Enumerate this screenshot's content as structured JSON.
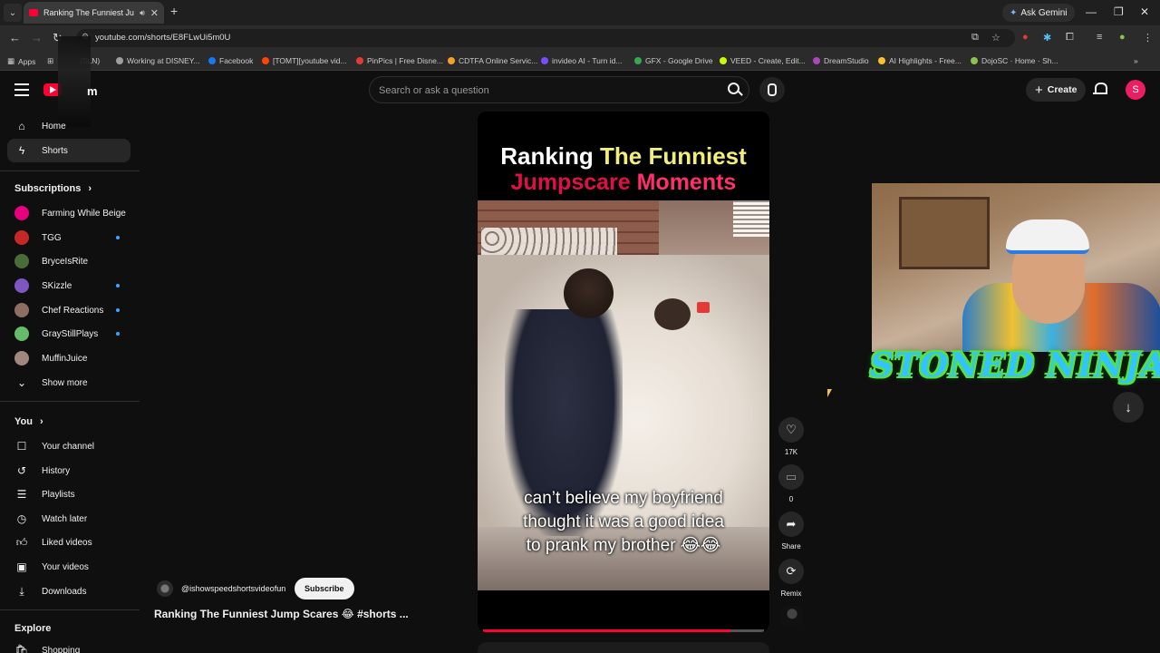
{
  "browser": {
    "tab_title": "Ranking The Funniest Jump",
    "url": "youtube.com/shorts/E8FLwUi5m0U",
    "ask_gemini": "Ask Gemini",
    "bookmarks": [
      {
        "label": "Apps",
        "color": "#8ab4f8"
      },
      {
        "label": "(SLN)",
        "color": "#cccccc"
      },
      {
        "label": "Working at DISNEY...",
        "color": "#9e9e9e"
      },
      {
        "label": "Facebook",
        "color": "#1877f2"
      },
      {
        "label": "[TOMT][youtube vid...",
        "color": "#ff4500"
      },
      {
        "label": "PinPics | Free Disne...",
        "color": "#e53935"
      },
      {
        "label": "CDTFA Online Servic...",
        "color": "#f4a02a"
      },
      {
        "label": "invideo AI - Turn id...",
        "color": "#7c4dff"
      },
      {
        "label": "GFX - Google Drive",
        "color": "#34a853"
      },
      {
        "label": "VEED - Create, Edit...",
        "color": "#c6ff00"
      },
      {
        "label": "DreamStudio",
        "color": "#ab47bc"
      },
      {
        "label": "AI Highlights - Free...",
        "color": "#fbc02d"
      },
      {
        "label": "DojoSC · Home · Sh...",
        "color": "#8bc34a"
      }
    ]
  },
  "header": {
    "logo_text": "m",
    "search_placeholder": "Search or ask a question",
    "create_label": "Create",
    "avatar_letter": "S"
  },
  "sidebar": {
    "main": [
      {
        "label": "Home",
        "icon": "home-icon"
      },
      {
        "label": "Shorts",
        "icon": "shorts-icon"
      }
    ],
    "subscriptions_heading": "Subscriptions",
    "subscriptions": [
      {
        "label": "Farming While Beige",
        "color": "#e6007e",
        "live": false
      },
      {
        "label": "TGG",
        "color": "#c62828",
        "live": true
      },
      {
        "label": "BryceIsRite",
        "color": "#4a6b3a",
        "live": false
      },
      {
        "label": "SKizzle",
        "color": "#7e57c2",
        "live": true
      },
      {
        "label": "Chef Reactions",
        "color": "#8d6e63",
        "live": true
      },
      {
        "label": "GrayStillPlays",
        "color": "#66bb6a",
        "live": true
      },
      {
        "label": "MuffinJuice",
        "color": "#a1887f",
        "live": false
      }
    ],
    "show_more": "Show more",
    "you_heading": "You",
    "you_items": [
      {
        "label": "Your channel",
        "icon": "channel-icon"
      },
      {
        "label": "History",
        "icon": "history-icon"
      },
      {
        "label": "Playlists",
        "icon": "playlists-icon"
      },
      {
        "label": "Watch later",
        "icon": "watch-later-icon"
      },
      {
        "label": "Liked videos",
        "icon": "thumbs-up-icon"
      },
      {
        "label": "Your videos",
        "icon": "your-videos-icon"
      },
      {
        "label": "Downloads",
        "icon": "download-icon"
      }
    ],
    "explore_heading": "Explore",
    "explore_items": [
      {
        "label": "Shopping",
        "icon": "shopping-icon"
      }
    ]
  },
  "short": {
    "overlay_line1_a": "Ranking ",
    "overlay_line1_b": "The Funniest",
    "overlay_line2_a": "Jumpscare ",
    "overlay_line2_b": "Moments",
    "caption_line1": "can’t believe my boyfriend",
    "caption_line2": "thought it was a good idea",
    "caption_line3": "to prank my brother 😂😂",
    "progress": 0.88,
    "channel_handle": "@ishowspeedshortsvideofun",
    "subscribe_label": "Subscribe",
    "title": "Ranking The Funniest Jump Scares 😂 #shorts ..."
  },
  "actions": {
    "likes": "17K",
    "comments": "0",
    "share": "Share",
    "remix": "Remix"
  },
  "overlay": {
    "streamer_name": "STONED NINJA"
  }
}
